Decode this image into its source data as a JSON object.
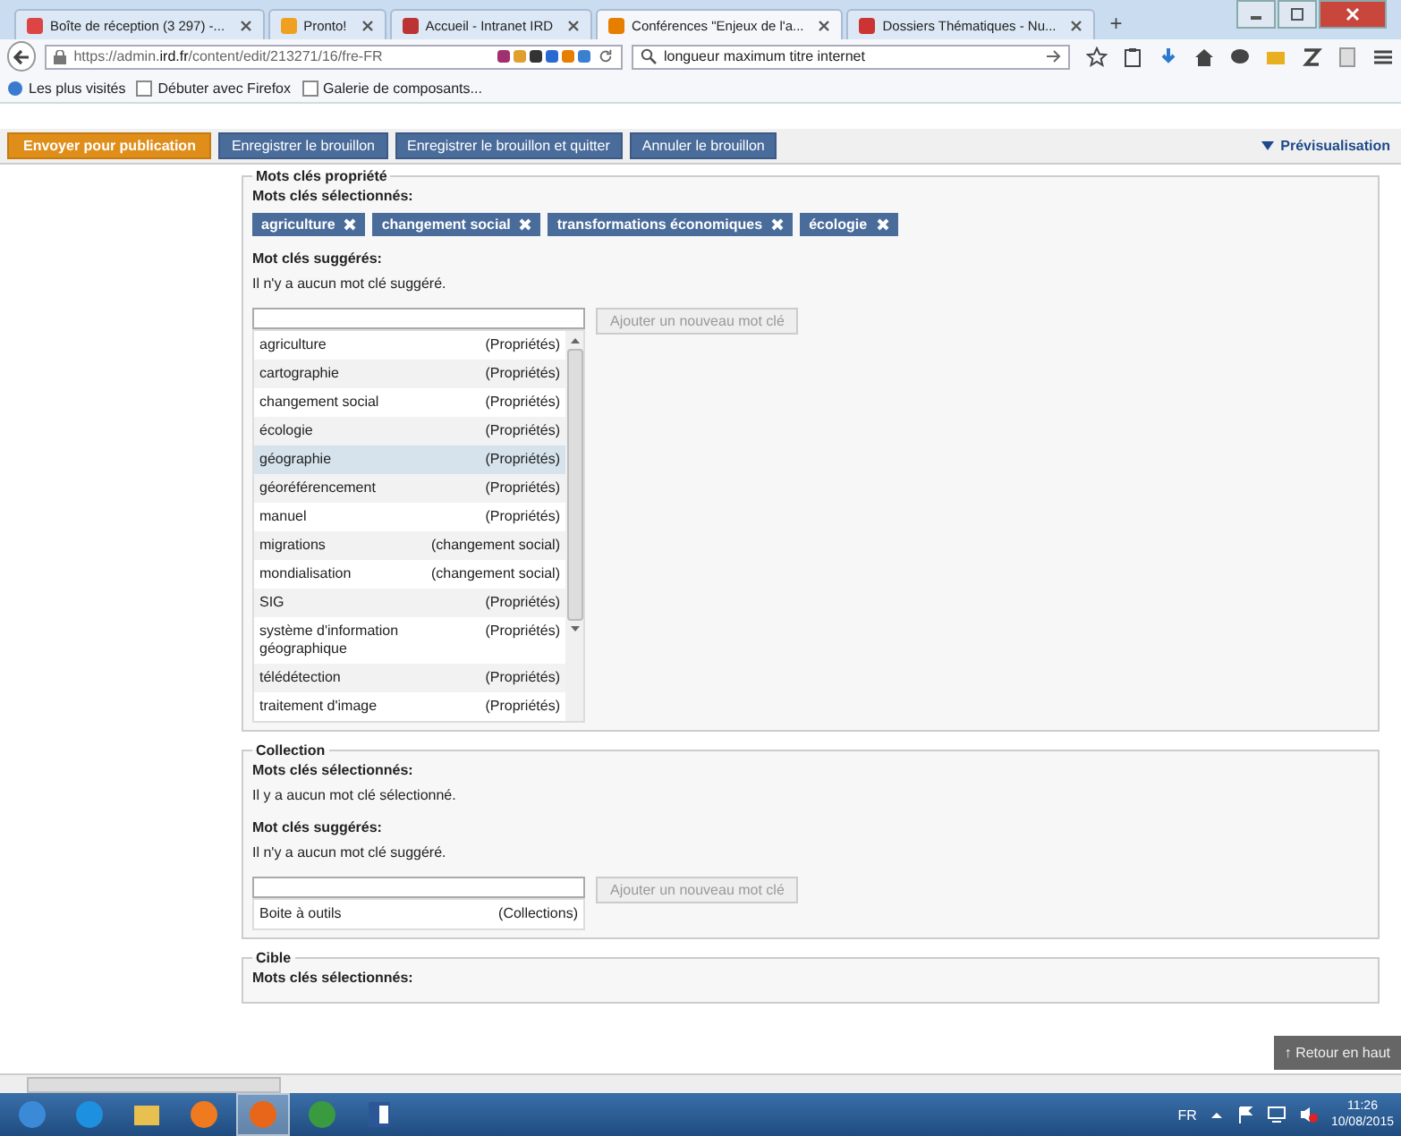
{
  "browser": {
    "tabs": [
      {
        "title": "Boîte de réception (3 297) -...",
        "selected": false
      },
      {
        "title": "Pronto!",
        "selected": false
      },
      {
        "title": "Accueil - Intranet IRD",
        "selected": false
      },
      {
        "title": "Conférences \"Enjeux de l'a...",
        "selected": true
      },
      {
        "title": "Dossiers Thématiques - Nu...",
        "selected": false
      }
    ],
    "new_tab": "+",
    "url_host": "https://admin.",
    "url_domain": "ird.fr",
    "url_path": "/content/edit/213271/16/fre-FR",
    "search": "longueur maximum titre internet",
    "bookmarks": [
      {
        "label": "Les plus visités",
        "kind": "link"
      },
      {
        "label": "Débuter avec Firefox",
        "kind": "page"
      },
      {
        "label": "Galerie de composants...",
        "kind": "page"
      }
    ]
  },
  "actions": [
    {
      "label": "Envoyer pour publication",
      "kind": "primary"
    },
    {
      "label": "Enregistrer le brouillon",
      "kind": "secondary"
    },
    {
      "label": "Enregistrer le brouillon et quitter",
      "kind": "secondary"
    },
    {
      "label": "Annuler le brouillon",
      "kind": "secondary"
    }
  ],
  "preview": "Prévisualisation",
  "sections": [
    {
      "legend": "Mots clés propriété",
      "selected_heading": "Mots clés sélectionnés:",
      "selected_tags": [
        "agriculture",
        "changement social",
        "transformations économiques",
        "écologie"
      ],
      "suggested_heading": "Mot clés suggérés:",
      "suggested_empty": "Il n'y a aucun mot clé suggéré.",
      "add_button": "Ajouter un nouveau mot clé",
      "scrollable": true,
      "list": [
        {
          "name": "agriculture",
          "category": "(Propriétés)",
          "selected": false
        },
        {
          "name": "cartographie",
          "category": "(Propriétés)",
          "selected": false
        },
        {
          "name": "changement social",
          "category": "(Propriétés)",
          "selected": false
        },
        {
          "name": "écologie",
          "category": "(Propriétés)",
          "selected": false
        },
        {
          "name": "géographie",
          "category": "(Propriétés)",
          "selected": true
        },
        {
          "name": "géoréférencement",
          "category": "(Propriétés)",
          "selected": false
        },
        {
          "name": "manuel",
          "category": "(Propriétés)",
          "selected": false
        },
        {
          "name": "migrations",
          "category": "(changement social)",
          "selected": false
        },
        {
          "name": "mondialisation",
          "category": "(changement social)",
          "selected": false
        },
        {
          "name": "SIG",
          "category": "(Propriétés)",
          "selected": false
        },
        {
          "name": "système d'information géographique",
          "category": "(Propriétés)",
          "selected": false
        },
        {
          "name": "télédétection",
          "category": "(Propriétés)",
          "selected": false
        },
        {
          "name": "traitement d'image",
          "category": "(Propriétés)",
          "selected": false
        }
      ]
    },
    {
      "legend": "Collection",
      "selected_heading": "Mots clés sélectionnés:",
      "selected_empty": "Il y a aucun mot clé sélectionné.",
      "suggested_heading": "Mot clés suggérés:",
      "suggested_empty": "Il n'y a aucun mot clé suggéré.",
      "add_button": "Ajouter un nouveau mot clé",
      "scrollable": false,
      "list": [
        {
          "name": "Boite à outils",
          "category": "(Collections)",
          "selected": false
        }
      ]
    },
    {
      "legend": "Cible",
      "selected_heading": "Mots clés sélectionnés:"
    }
  ],
  "back_to_top": "↑ Retour en haut",
  "taskbar": {
    "apps": [
      {
        "kind": "start",
        "active": false
      },
      {
        "kind": "ie",
        "active": false
      },
      {
        "kind": "folder",
        "active": false
      },
      {
        "kind": "media",
        "active": false
      },
      {
        "kind": "firefox",
        "active": true
      },
      {
        "kind": "chrome",
        "active": false
      },
      {
        "kind": "word",
        "active": false
      }
    ],
    "language": "FR",
    "time": "11:26",
    "date": "10/08/2015"
  }
}
